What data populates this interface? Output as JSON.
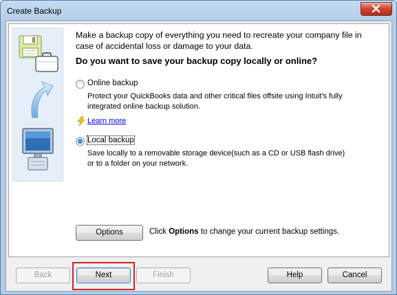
{
  "window": {
    "title": "Create Backup"
  },
  "content": {
    "intro": "Make a backup copy of everything you need to recreate your company file in case of accidental loss or damage to your data.",
    "question": "Do you want to save your backup copy locally or online?"
  },
  "options": {
    "online": {
      "label": "Online backup",
      "selected": false,
      "description": "Protect your QuickBooks data and other critical files offsite using Intuit's fully integrated online backup solution.",
      "learn_more": "Learn more"
    },
    "local": {
      "label": "Local backup",
      "selected": true,
      "description": "Save locally to a removable storage device(such as a CD or USB flash drive) or to a folder on your network."
    }
  },
  "options_button": {
    "label": "Options",
    "note_prefix": "Click",
    "note_bold": "Options",
    "note_suffix": "to change your current backup settings."
  },
  "footer": {
    "back": "Back",
    "next": "Next",
    "finish": "Finish",
    "help": "Help",
    "cancel": "Cancel"
  },
  "icons": {
    "sidebar": [
      "floppy-disk-icon",
      "briefcase-icon",
      "curved-arrow-icon",
      "monitor-icon"
    ],
    "learn_more": "lightning-bolt-icon",
    "close": "close-icon"
  },
  "colors": {
    "highlight_box": "#d42020",
    "link": "#0000ee"
  }
}
